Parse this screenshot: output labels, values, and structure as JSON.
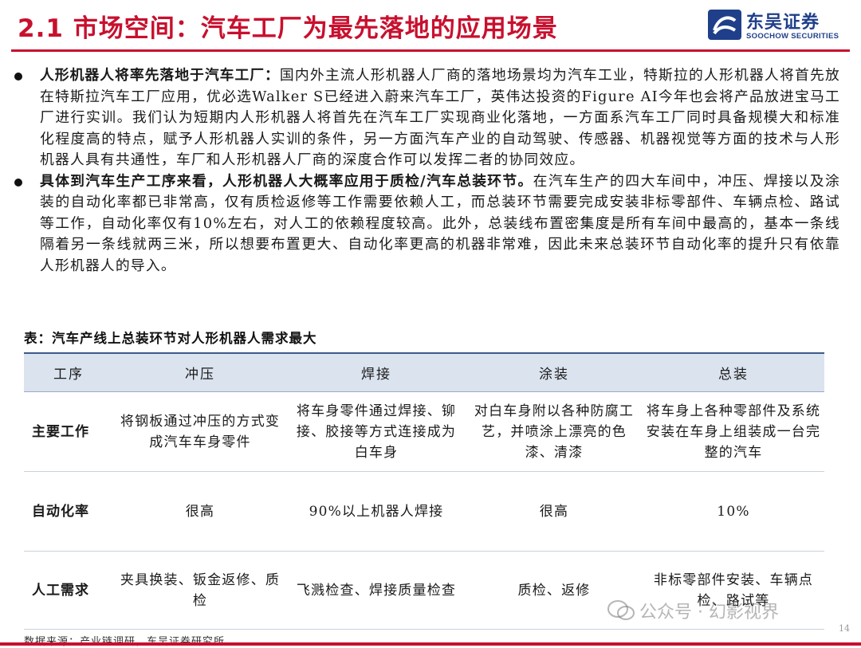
{
  "header": {
    "title": "2.1 市场空间：汽车工厂为最先落地的应用场景",
    "logo_cn": "东吴证券",
    "logo_en": "SOOCHOW SECURITIES",
    "accent_color": "#c8102e",
    "brand_color": "#1f3f8a"
  },
  "bullets": [
    {
      "lead": "人形机器人将率先落地于汽车工厂：",
      "text": "国内外主流人形机器人厂商的落地场景均为汽车工业，特斯拉的人形机器人将首先放在特斯拉汽车工厂应用，优必选Walker S已经进入蔚来汽车工厂，英伟达投资的Figure AI今年也会将产品放进宝马工厂进行实训。我们认为短期内人形机器人将首先在汽车工厂实现商业化落地，一方面系汽车工厂同时具备规模大和标准化程度高的特点，赋予人形机器人实训的条件，另一方面汽车产业的自动驾驶、传感器、机器视觉等方面的技术与人形机器人具有共通性，车厂和人形机器人厂商的深度合作可以发挥二者的协同效应。"
    },
    {
      "lead": "具体到汽车生产工序来看，人形机器人大概率应用于质检/汽车总装环节。",
      "text": "在汽车生产的四大车间中，冲压、焊接以及涂装的自动化率都已非常高，仅有质检返修等工作需要依赖人工，而总装环节需要完成安装非标零部件、车辆点检、路试等工作，自动化率仅有10%左右，对人工的依赖程度较高。此外，总装线布置密集度是所有车间中最高的，基本一条线隔着另一条线就两三米，所以想要布置更大、自动化率更高的机器非常难，因此未来总装环节自动化率的提升只有依靠人形机器人的导入。"
    }
  ],
  "table": {
    "caption": "表：汽车产线上总装环节对人形机器人需求最大",
    "headers": [
      "工序",
      "冲压",
      "焊接",
      "涂装",
      "总装"
    ],
    "rows": [
      {
        "label": "主要工作",
        "cells": [
          "将钢板通过冲压的方式变成汽车车身零件",
          "将车身零件通过焊接、铆接、胶接等方式连接成为白车身",
          "对白车身附以各种防腐工艺，并喷涂上漂亮的色漆、清漆",
          "将车身上各种零部件及系统安装在车身上组装成一台完整的汽车"
        ]
      },
      {
        "label": "自动化率",
        "cells": [
          "很高",
          "90%以上机器人焊接",
          "很高",
          "10%"
        ]
      },
      {
        "label": "人工需求",
        "cells": [
          "夹具换装、钣金返修、质检",
          "飞溅检查、焊接质量检查",
          "质检、返修",
          "非标零部件安装、车辆点检、路试等"
        ]
      }
    ]
  },
  "footer": {
    "source": "数据来源：产业链调研，东吴证券研究所",
    "page_number": "14",
    "watermark": "公众号 · 幻影视界"
  }
}
